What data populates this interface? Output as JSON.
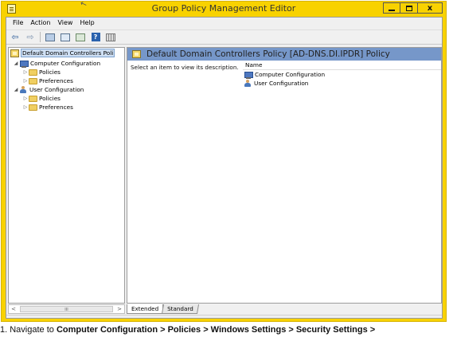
{
  "window": {
    "title": "Group Policy Management Editor",
    "controls": [
      "minimize",
      "maximize",
      "close"
    ]
  },
  "menu": [
    "File",
    "Action",
    "View",
    "Help"
  ],
  "toolbar": {
    "buttons": [
      {
        "name": "back",
        "icon": "back-arrow-icon"
      },
      {
        "name": "forward",
        "icon": "forward-arrow-icon"
      },
      {
        "name": "show-hide-tree",
        "icon": "tree-pane-icon"
      },
      {
        "name": "properties",
        "icon": "properties-icon"
      },
      {
        "name": "export-list",
        "icon": "export-list-icon"
      },
      {
        "name": "help",
        "icon": "help-icon",
        "label": "?"
      },
      {
        "name": "show-columns",
        "icon": "columns-icon"
      }
    ]
  },
  "tree": {
    "root": "Default Domain Controllers Poli",
    "items": [
      {
        "label": "Computer Configuration",
        "icon": "computer-icon",
        "expanded": true
      },
      {
        "label": "Policies",
        "icon": "folder-icon",
        "expanded": false
      },
      {
        "label": "Preferences",
        "icon": "folder-icon",
        "expanded": false
      },
      {
        "label": "User Configuration",
        "icon": "user-icon",
        "expanded": true
      },
      {
        "label": "Policies",
        "icon": "folder-icon",
        "expanded": false
      },
      {
        "label": "Preferences",
        "icon": "folder-icon",
        "expanded": false
      }
    ]
  },
  "scrollbar": {
    "left": "<",
    "grip": "III",
    "right": ">"
  },
  "right_pane": {
    "title": "Default Domain Controllers Policy [AD-DNS.DI.IPDR] Policy",
    "description": "Select an item to view its description.",
    "column": "Name",
    "items": [
      {
        "label": "Computer Configuration",
        "icon": "computer-icon"
      },
      {
        "label": "User Configuration",
        "icon": "user-icon"
      }
    ]
  },
  "tabs": [
    "Extended",
    "Standard"
  ],
  "bottom_text": {
    "prefix": "1. Navigate to ",
    "path": "Computer Configuration > Policies > Windows Settings > Security Settings >"
  },
  "colors": {
    "title_bar": "#f8d200",
    "header": "#7697c9"
  }
}
